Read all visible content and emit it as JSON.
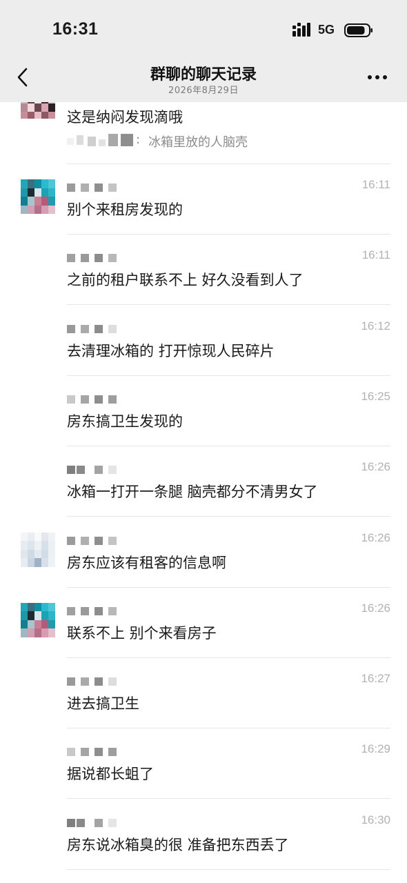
{
  "status_bar": {
    "time": "16:31",
    "network": "5G",
    "signal_icon": "signal-bars-icon",
    "battery_icon": "battery-icon",
    "battery_level": 0.85
  },
  "nav": {
    "title": "群聊的聊天记录",
    "subtitle": "2026年8月29日",
    "back_icon": "chevron-left-icon",
    "more_icon": "more-dots-icon"
  },
  "first_message": {
    "text": "这是纳闷发现滴哦",
    "quote_text": "冰箱里放的人脑壳",
    "quote_prefix": ":"
  },
  "messages": [
    {
      "time": "16:11",
      "text": "别个来租房发现的",
      "show_avatar": true,
      "avatar_style": "teal"
    },
    {
      "time": "16:11",
      "text": "之前的租户联系不上 好久没看到人了",
      "show_avatar": false
    },
    {
      "time": "16:12",
      "text": "去清理冰箱的 打开惊现人民碎片",
      "show_avatar": false
    },
    {
      "time": "16:25",
      "text": "房东搞卫生发现的",
      "show_avatar": false
    },
    {
      "time": "16:26",
      "text": "冰箱一打开一条腿 脑壳都分不清男女了",
      "show_avatar": false
    },
    {
      "time": "16:26",
      "text": "房东应该有租客的信息啊",
      "show_avatar": true,
      "avatar_style": "light"
    },
    {
      "time": "16:26",
      "text": "联系不上 别个来看房子",
      "show_avatar": true,
      "avatar_style": "teal"
    },
    {
      "time": "16:27",
      "text": "进去搞卫生",
      "show_avatar": false
    },
    {
      "time": "16:29",
      "text": "据说都长蛆了",
      "show_avatar": false
    },
    {
      "time": "16:30",
      "text": "房东说冰箱臭的很 准备把东西丢了",
      "show_avatar": false
    }
  ],
  "colors": {
    "header_bg": "#ededed",
    "time_text": "#b2b2b2",
    "quote_text": "#8c8c8c",
    "divider": "#e6e6e6"
  }
}
